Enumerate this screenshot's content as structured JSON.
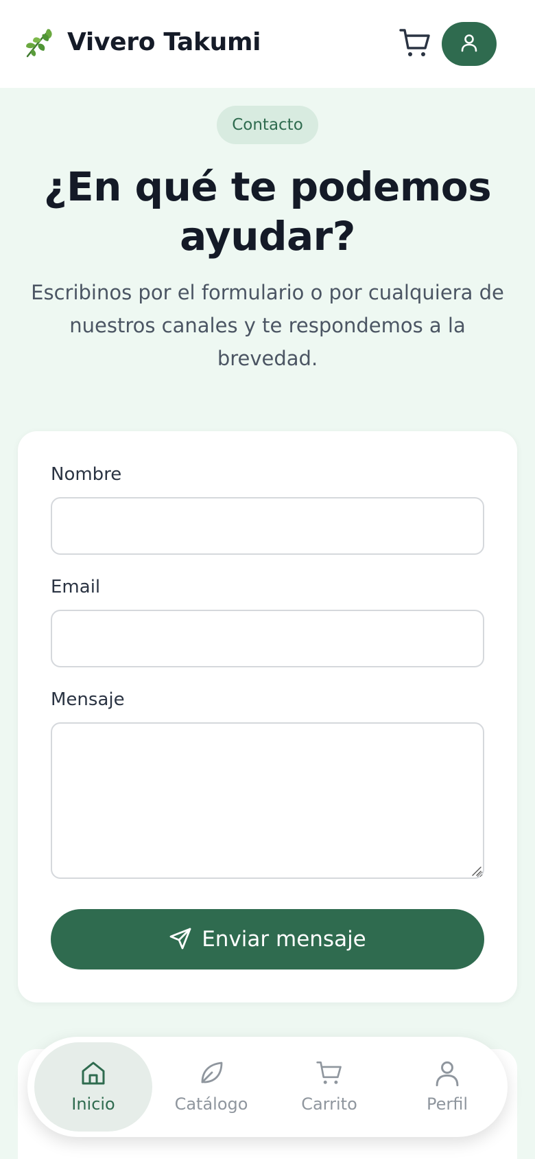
{
  "header": {
    "brand_name": "Vivero Takumi",
    "logo_icon": "leaf-sprig-icon",
    "cart_icon": "cart-icon",
    "profile_icon": "user-icon"
  },
  "hero": {
    "pill_label": "Contacto",
    "title": "¿En qué te podemos ayudar?",
    "subtitle": "Escribinos por el formulario o por cualquiera de nuestros canales y te respondemos a la brevedad."
  },
  "form": {
    "name_label": "Nombre",
    "name_value": "",
    "email_label": "Email",
    "email_value": "",
    "message_label": "Mensaje",
    "message_value": "",
    "submit_label": "Enviar mensaje",
    "submit_icon": "send-icon"
  },
  "bottom_nav": {
    "items": [
      {
        "label": "Inicio",
        "icon": "home-icon",
        "active": true
      },
      {
        "label": "Catálogo",
        "icon": "leaf-icon",
        "active": false
      },
      {
        "label": "Carrito",
        "icon": "cart-icon",
        "active": false
      },
      {
        "label": "Perfil",
        "icon": "user-icon",
        "active": false
      }
    ]
  },
  "colors": {
    "primary": "#2f6b4f",
    "background": "#eef8f2",
    "pill_background": "#d8ebe0",
    "text_dark": "#141a27",
    "text_muted": "#4b5563",
    "nav_inactive": "#8f969e"
  }
}
